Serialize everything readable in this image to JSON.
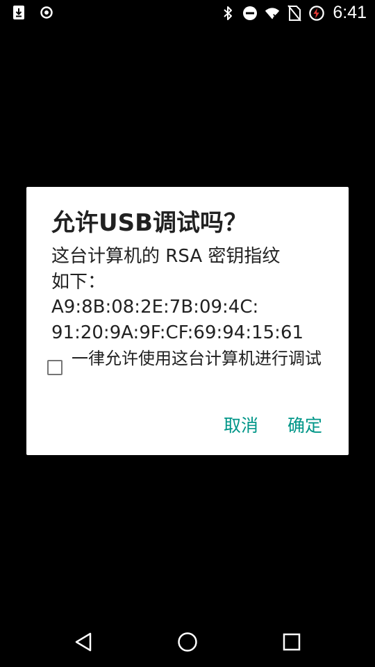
{
  "status_bar": {
    "time": "6:41",
    "icons_left": [
      "download-icon",
      "sync-icon"
    ],
    "icons_right": [
      "bluetooth-icon",
      "do-not-disturb-icon",
      "wifi-icon",
      "no-sim-icon",
      "battery-charging-icon"
    ]
  },
  "dialog": {
    "title": "允许USB调试吗？",
    "message_lines": [
      "这台计算机的 RSA 密钥指纹",
      "如下：",
      "A9:8B:08:2E:7B:09:4C:",
      "91:20:9A:9F:CF:69:94:15:61"
    ],
    "checkbox_label": "一律允许使用这台计算机进行调试",
    "checkbox_checked": false,
    "cancel_label": "取消",
    "ok_label": "确定",
    "accent_color": "#009688"
  },
  "nav_bar": {
    "icons": [
      "back-icon",
      "home-icon",
      "recents-icon"
    ]
  }
}
